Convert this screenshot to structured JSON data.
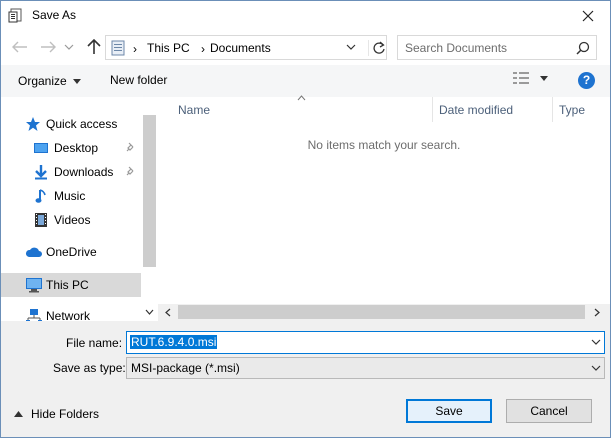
{
  "window": {
    "title": "Save As",
    "close_icon": "close-icon"
  },
  "nav": {
    "back_icon": "back-arrow-icon",
    "forward_icon": "forward-arrow-icon",
    "recent_icon": "chevron-down-icon",
    "up_icon": "up-arrow-icon"
  },
  "address": {
    "icon": "this-pc-icon",
    "items": [
      "This PC",
      "Documents"
    ],
    "separator": "›"
  },
  "search": {
    "placeholder": "Search Documents"
  },
  "toolbar": {
    "organize_label": "Organize",
    "new_folder_label": "New folder",
    "help_label": "?"
  },
  "sidebar": {
    "items": [
      {
        "label": "Quick access",
        "icon": "star-icon"
      },
      {
        "label": "Desktop",
        "icon": "desktop-folder-icon",
        "pinned": true
      },
      {
        "label": "Downloads",
        "icon": "download-arrow-icon",
        "pinned": true
      },
      {
        "label": "Music",
        "icon": "music-note-icon"
      },
      {
        "label": "Videos",
        "icon": "film-icon"
      },
      {
        "label": "OneDrive",
        "icon": "cloud-icon"
      },
      {
        "label": "This PC",
        "icon": "monitor-icon",
        "selected": true
      },
      {
        "label": "Network",
        "icon": "network-icon"
      }
    ]
  },
  "content": {
    "columns": [
      "Name",
      "Date modified",
      "Type"
    ],
    "empty_message": "No items match your search."
  },
  "form": {
    "file_name_label": "File name:",
    "file_name_value": "RUT.6.9.4.0.msi",
    "save_type_label": "Save as type:",
    "save_type_value": "MSI-package (*.msi)"
  },
  "footer": {
    "hide_folders_label": "Hide Folders",
    "save_label": "Save",
    "cancel_label": "Cancel"
  },
  "colors": {
    "accent": "#0078d7",
    "help": "#1e73d0",
    "selected_row": "#d9d9d9",
    "folder_blue": "#1e73d0"
  }
}
